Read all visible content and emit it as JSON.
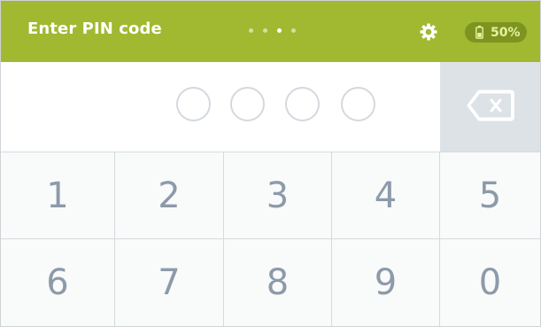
{
  "header": {
    "title": "Enter PIN code",
    "page_dots": {
      "count": 4,
      "active_index": 2
    },
    "settings_icon": "gear-icon",
    "battery": {
      "icon": "battery-icon",
      "label": "50%"
    },
    "colors": {
      "bar": "#a0b930",
      "battery_pill": "#7e9421",
      "battery_text": "#e6f29d"
    }
  },
  "pin": {
    "digits_total": 4,
    "digits_entered": 0,
    "backspace_icon": "backspace-icon"
  },
  "keypad": {
    "keys": [
      "1",
      "2",
      "3",
      "4",
      "5",
      "6",
      "7",
      "8",
      "9",
      "0"
    ],
    "colors": {
      "key_text": "#8c9aa9",
      "grid": "#d6dadd"
    }
  }
}
